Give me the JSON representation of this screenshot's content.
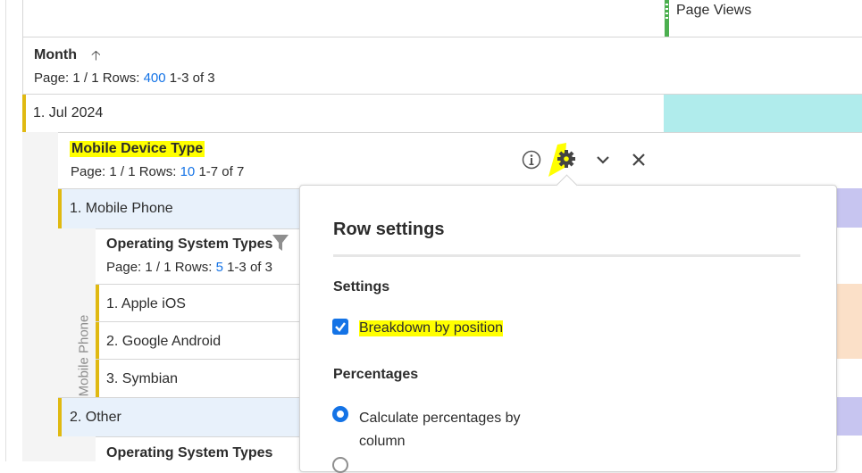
{
  "columns": {
    "metric": "Page Views"
  },
  "month_table": {
    "header": "Month",
    "pager": {
      "page_label": "Page: 1 / 1 Rows:",
      "rows": "400",
      "range": "1-3 of 3"
    },
    "rows": [
      {
        "label": "1.  Jul 2024"
      }
    ]
  },
  "device_breakdown": {
    "header": "Mobile Device Type",
    "pager": {
      "page_label": "Page: 1 / 1 Rows:",
      "rows": "10",
      "range": "1-7 of 7"
    },
    "rows": [
      {
        "label": "1.  Mobile Phone"
      },
      {
        "label": "2.  Other"
      }
    ],
    "vertical_label": "Mobile Phone"
  },
  "os_breakdown": {
    "header": "Operating System Types",
    "pager": {
      "page_label": "Page: 1 / 1 Rows:",
      "rows": "5",
      "range": "1-3 of 3"
    },
    "rows": [
      {
        "label": "1.  Apple iOS"
      },
      {
        "label": "2.  Google Android"
      },
      {
        "label": "3.  Symbian"
      }
    ],
    "second_header": "Operating System Types"
  },
  "icons": {
    "sort": "arrow-up-icon",
    "info": "info-icon",
    "gear": "gear-icon",
    "chevron": "chevron-down-icon",
    "close": "close-icon",
    "filter": "filter-icon"
  },
  "row_settings": {
    "title": "Row settings",
    "settings_heading": "Settings",
    "breakdown_by_position": {
      "label": "Breakdown by position",
      "checked": true
    },
    "percentages_heading": "Percentages",
    "calc_by_column": {
      "label": "Calculate percentages by column",
      "selected": true
    }
  },
  "colors": {
    "highlight": "#ffff00",
    "accent": "#1473e6",
    "row_bar": "#e0b911",
    "metric_marker": "#4caf50",
    "jul_cell": "#b0ecec",
    "mobile_cell": "#c7c5f0",
    "apple_cell": "#fbe0c8"
  }
}
